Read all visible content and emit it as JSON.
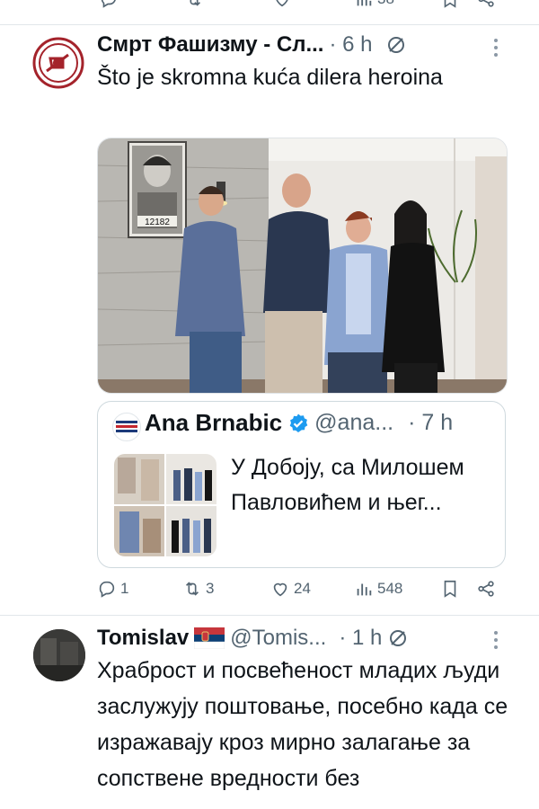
{
  "prev_actions": {
    "views": "38"
  },
  "tweet1": {
    "author": "Смрт Фашизму - Сл...",
    "time": "· 6 h",
    "text": "Što je skromna kuća dilera heroina",
    "photo_number": "12182",
    "quote": {
      "author": "Ana Brnabic",
      "handle": "@ana...",
      "time": "· 7 h",
      "text": "У Добоју, са Милошем Павловићем и њег...",
      "avatar_text": "СРПСКА НАПРЕДНА СТРАНКА"
    },
    "actions": {
      "replies": "1",
      "reposts": "3",
      "likes": "24",
      "views": "548"
    }
  },
  "tweet2": {
    "author": "Tomislav",
    "flag": "serbia-flag",
    "handle": "@Tomis...",
    "time": "· 1 h",
    "text": "Храброст и посвећеност младих људи заслужују поштовање, посебно када се изражавају кроз мирно залагање за сопствене вредности без"
  },
  "colors": {
    "text": "#0f1419",
    "muted": "#536471",
    "verified": "#1d9bf0",
    "logo": "#a4232b",
    "divider": "#e1e6ea"
  },
  "icons": [
    "reply-icon",
    "repost-icon",
    "like-icon",
    "views-icon",
    "bookmark-icon",
    "share-icon",
    "grok-icon",
    "more-icon",
    "verified-icon"
  ]
}
